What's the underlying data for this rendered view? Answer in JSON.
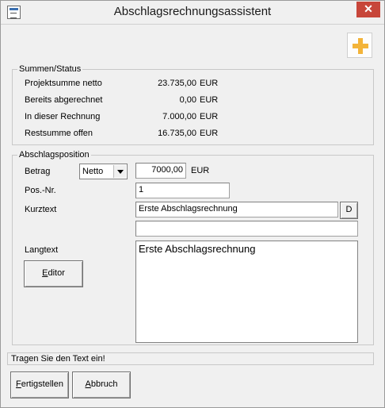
{
  "window": {
    "title": "Abschlagsrechnungsassistent",
    "close_symbol": "✕"
  },
  "summary": {
    "legend": "Summen/Status",
    "rows": [
      {
        "label": "Projektsumme netto",
        "value": "23.735,00",
        "unit": "EUR"
      },
      {
        "label": "Bereits abgerechnet",
        "value": "0,00",
        "unit": "EUR"
      },
      {
        "label": "In dieser Rechnung",
        "value": "7.000,00",
        "unit": "EUR"
      },
      {
        "label": "Restsumme offen",
        "value": "16.735,00",
        "unit": "EUR"
      }
    ]
  },
  "position": {
    "legend": "Abschlagsposition",
    "betrag_label": "Betrag",
    "betrag_type_selected": "Netto",
    "betrag_value": "7000,00",
    "betrag_unit": "EUR",
    "posnr_label": "Pos.-Nr.",
    "posnr_value": "1",
    "kurztext_label": "Kurztext",
    "kurztext_value": "Erste Abschlagsrechnung",
    "kurztext_button": "D",
    "kurztext_extra_value": "",
    "langtext_label": "Langtext",
    "langtext_value": "Erste Abschlagsrechnung",
    "editor_button_mnemonic": "E",
    "editor_button_rest": "ditor"
  },
  "status_text": "Tragen Sie den Text ein!",
  "buttons": {
    "finish_mnemonic": "F",
    "finish_rest": "ertigstellen",
    "cancel_mnemonic": "A",
    "cancel_rest": "bbruch"
  },
  "icons": {
    "window_icon": "form-icon",
    "add": "plus-icon"
  },
  "colors": {
    "close_button": "#c7463a",
    "plus_icon": "#f3b43a"
  }
}
